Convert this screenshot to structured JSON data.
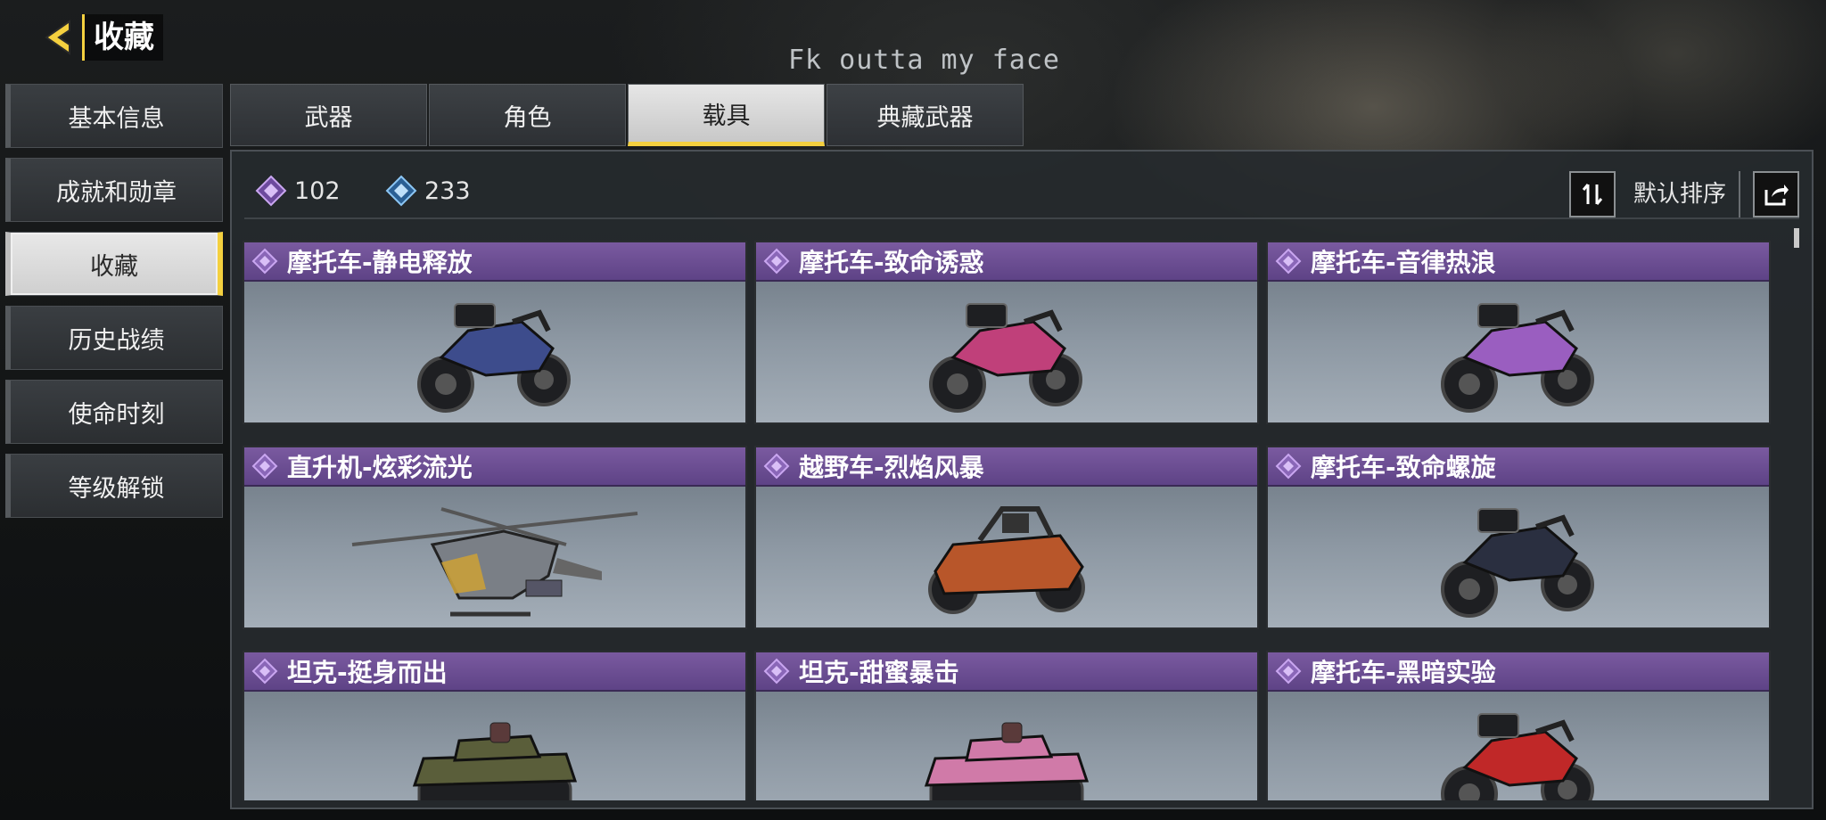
{
  "header": {
    "title": "收藏",
    "back_icon": "back-arrow-icon",
    "overlay_text": "Fk outta my face"
  },
  "sidenav": {
    "items": [
      {
        "label": "基本信息",
        "active": false
      },
      {
        "label": "成就和勋章",
        "active": false
      },
      {
        "label": "收藏",
        "active": true
      },
      {
        "label": "历史战绩",
        "active": false
      },
      {
        "label": "使命时刻",
        "active": false
      },
      {
        "label": "等级解锁",
        "active": false
      }
    ]
  },
  "tabs": [
    {
      "label": "武器",
      "active": false
    },
    {
      "label": "角色",
      "active": false
    },
    {
      "label": "载具",
      "active": true
    },
    {
      "label": "典藏武器",
      "active": false
    }
  ],
  "toolbar": {
    "stat_purple": {
      "icon": "purple-diamond-icon",
      "value": "102"
    },
    "stat_blue": {
      "icon": "blue-diamond-icon",
      "value": "233"
    },
    "sort_icon": "sort-toggle-icon",
    "sort_label": "默认排序",
    "share_icon": "share-icon"
  },
  "colors": {
    "accent": "#f4d03f",
    "card_header": "#6b4d94",
    "purple_rarity": "#b085e0",
    "blue_rarity": "#5aa8e8"
  },
  "vehicles": [
    {
      "title": "摩托车-静电释放",
      "kind": "motorcycle",
      "tint": "#3d4c8c"
    },
    {
      "title": "摩托车-致命诱惑",
      "kind": "motorcycle",
      "tint": "#c0407a"
    },
    {
      "title": "摩托车-音律热浪",
      "kind": "motorcycle",
      "tint": "#9a5ec0"
    },
    {
      "title": "直升机-炫彩流光",
      "kind": "helicopter",
      "tint": "#c9a03a"
    },
    {
      "title": "越野车-烈焰风暴",
      "kind": "buggy",
      "tint": "#b8562a"
    },
    {
      "title": "摩托车-致命螺旋",
      "kind": "motorcycle",
      "tint": "#2a2f40"
    },
    {
      "title": "坦克-挺身而出",
      "kind": "tank",
      "tint": "#5a5e3a"
    },
    {
      "title": "坦克-甜蜜暴击",
      "kind": "tank",
      "tint": "#d07aa8"
    },
    {
      "title": "摩托车-黑暗实验",
      "kind": "motorcycle",
      "tint": "#c02828"
    }
  ]
}
